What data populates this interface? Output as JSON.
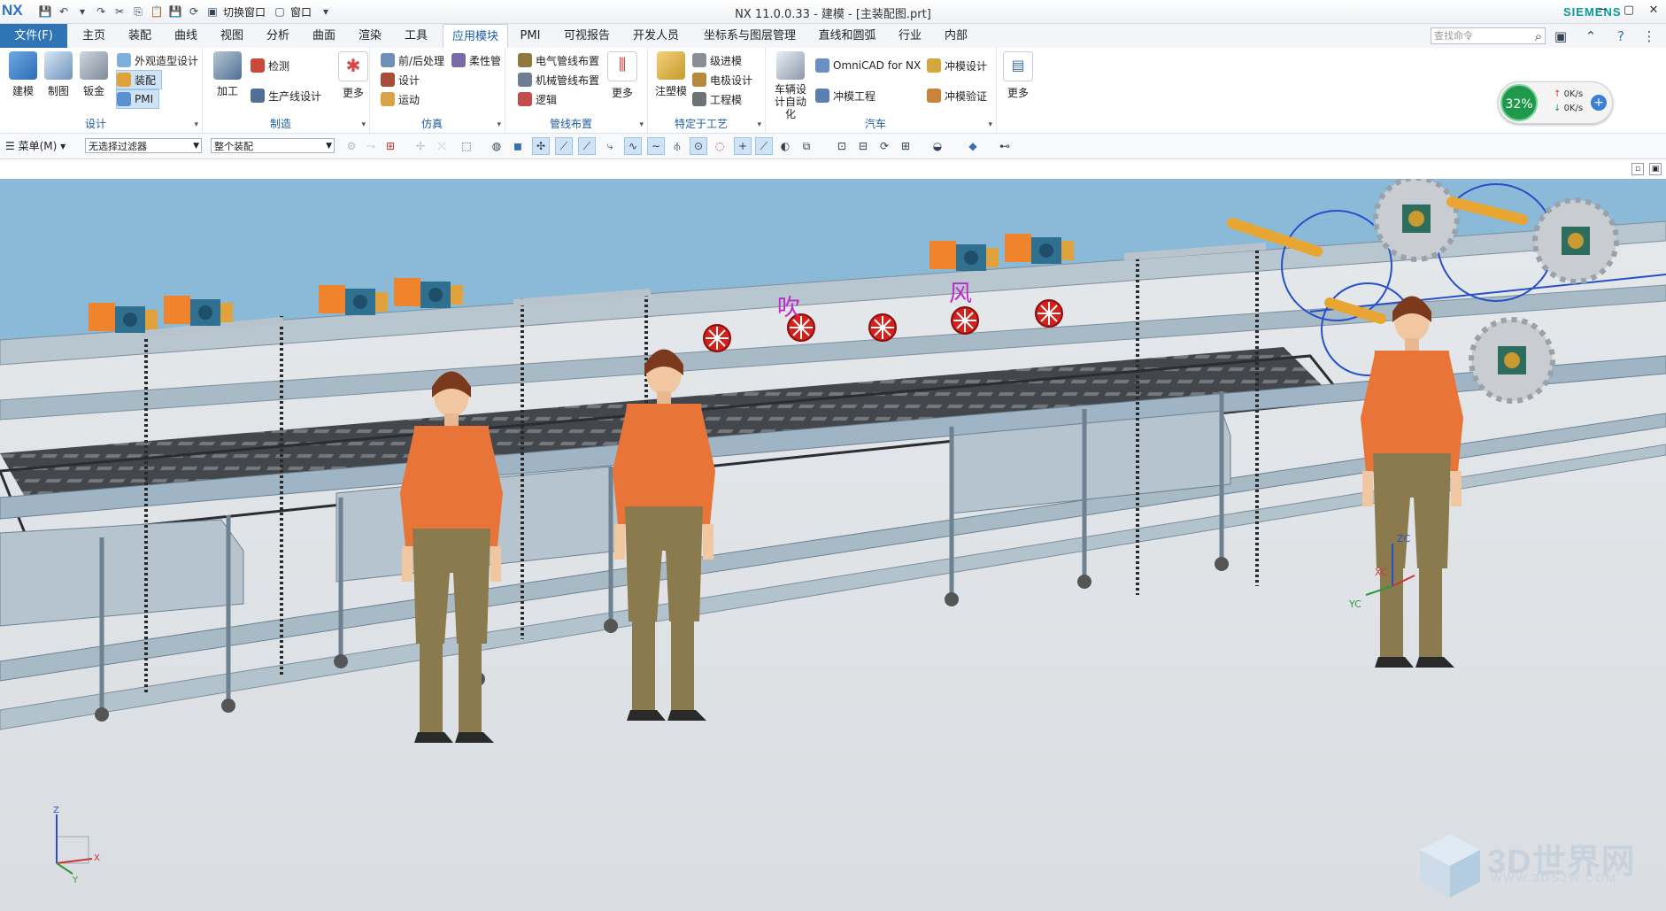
{
  "app": {
    "logo": "NX",
    "title": "NX 11.0.0.33 - 建模 - [主装配图.prt]",
    "brand": "SIEMENS",
    "switch_window": "切换窗口",
    "window_menu": "窗口"
  },
  "file_tab": "文件(F)",
  "tabs": [
    "主页",
    "装配",
    "曲线",
    "视图",
    "分析",
    "曲面",
    "渲染",
    "工具",
    "应用模块",
    "PMI",
    "可视报告",
    "开发人员",
    "坐标系与图层管理",
    "直线和圆弧",
    "行业",
    "内部"
  ],
  "active_tab": "应用模块",
  "search": {
    "placeholder": "查找命令"
  },
  "ribbon": {
    "design": {
      "label": "设计",
      "big": [
        "建模",
        "制图",
        "钣金"
      ],
      "small": [
        "外观造型设计",
        "装配",
        "PMI"
      ]
    },
    "manufacture": {
      "label": "制造",
      "big": [
        "加工"
      ],
      "small": [
        "检测",
        "生产线设计"
      ],
      "more": "更多"
    },
    "simulation": {
      "label": "仿真",
      "small": [
        "前/后处理",
        "设计",
        "运动",
        "柔性管"
      ]
    },
    "routing": {
      "label": "管线布置",
      "small": [
        "电气管线布置",
        "机械管线布置",
        "逻辑"
      ],
      "more": "更多"
    },
    "process": {
      "label": "特定于工艺",
      "big": [
        "注塑模"
      ],
      "small": [
        "级进模",
        "电极设计",
        "工程模"
      ]
    },
    "auto": {
      "label": "汽车",
      "big": [
        "车辆设计自动化"
      ],
      "small": [
        "OmniCAD for NX",
        "冲模工程",
        "冲模设计",
        "冲模验证"
      ]
    },
    "more_label": "更多"
  },
  "perf": {
    "percent": "32%",
    "up": "0K/s",
    "down": "0K/s"
  },
  "toolbar2": {
    "menu": "菜单(M)",
    "filter": "无选择过滤器",
    "assembly": "整个装配"
  },
  "scene": {
    "labels": [
      "吹",
      "风"
    ],
    "csys": [
      "XC",
      "YC",
      "ZC"
    ],
    "triad": [
      "Z",
      "X",
      "Y"
    ]
  },
  "watermark": {
    "text": "3D世界网",
    "url": "WWW.3DSJW.COM"
  },
  "colors": {
    "accent": "#2f74b5",
    "sky": "#8bbad9",
    "floor": "#dfe2e6",
    "frame": "#8fa6b6",
    "worker_shirt": "#e87437",
    "worker_pants": "#8c7a4f",
    "fan": "#d6201b",
    "label": "#c229c9",
    "pipe": "#e8a531",
    "gear": "#c9cdd2"
  }
}
